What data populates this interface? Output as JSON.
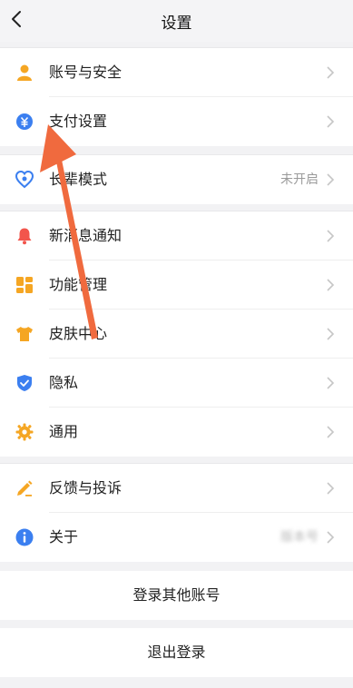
{
  "header": {
    "title": "设置"
  },
  "group1": [
    {
      "label": "账号与安全"
    },
    {
      "label": "支付设置"
    }
  ],
  "group2": [
    {
      "label": "长辈模式",
      "value": "未开启"
    }
  ],
  "group3": [
    {
      "label": "新消息通知"
    },
    {
      "label": "功能管理"
    },
    {
      "label": "皮肤中心"
    },
    {
      "label": "隐私"
    },
    {
      "label": "通用"
    }
  ],
  "group4": [
    {
      "label": "反馈与投诉"
    },
    {
      "label": "关于",
      "value": "版本号"
    }
  ],
  "actions": {
    "switch_account": "登录其他账号",
    "logout": "退出登录"
  },
  "colors": {
    "accent_blue": "#3b7ff0",
    "orange": "#f5a623",
    "red": "#f2554c",
    "arrow": "#f06a3e"
  }
}
